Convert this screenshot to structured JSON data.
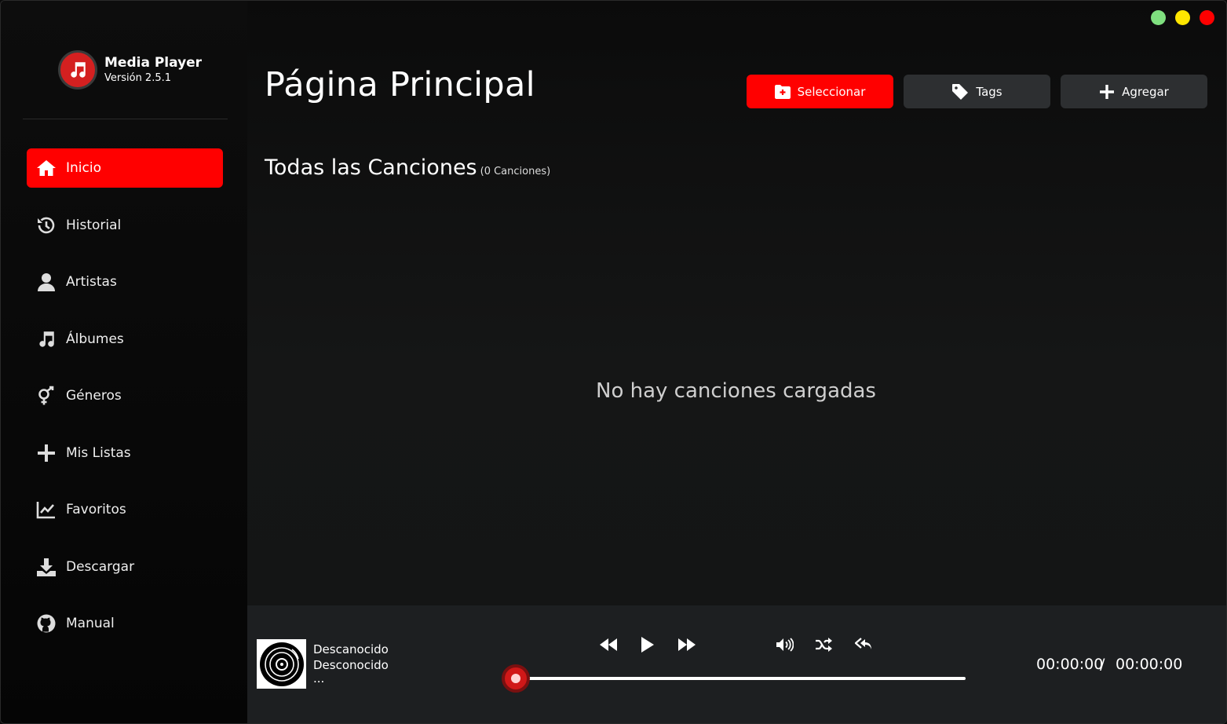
{
  "app": {
    "title": "Media Player",
    "version": "Versión 2.5.1"
  },
  "sidebar": {
    "items": [
      {
        "label": "Inicio",
        "icon": "home-icon",
        "active": true
      },
      {
        "label": "Historial",
        "icon": "history-icon",
        "active": false
      },
      {
        "label": "Artistas",
        "icon": "user-icon",
        "active": false
      },
      {
        "label": "Álbumes",
        "icon": "music-note-icon",
        "active": false
      },
      {
        "label": "Géneros",
        "icon": "genders-icon",
        "active": false
      },
      {
        "label": "Mis Listas",
        "icon": "plus-icon",
        "active": false
      },
      {
        "label": "Favoritos",
        "icon": "chart-line-icon",
        "active": false
      },
      {
        "label": "Descargar",
        "icon": "download-icon",
        "active": false
      },
      {
        "label": "Manual",
        "icon": "github-icon",
        "active": false
      }
    ]
  },
  "header": {
    "title": "Página Principal",
    "buttons": {
      "select": "Seleccionar",
      "tags": "Tags",
      "add": "Agregar"
    }
  },
  "main": {
    "section_title": "Todas las Canciones",
    "section_count": "(0 Canciones)",
    "empty_message": "No hay canciones cargadas"
  },
  "player": {
    "title": "Descanocido",
    "artist": "Desconocido",
    "extra": "...",
    "current_time": "00:00:00",
    "separator": "/",
    "total_time": "00:00:00",
    "progress": 0
  },
  "colors": {
    "accent": "#ff0000",
    "window_green": "#7fe07f",
    "window_yellow": "#ffe600",
    "window_red": "#ff0000"
  }
}
